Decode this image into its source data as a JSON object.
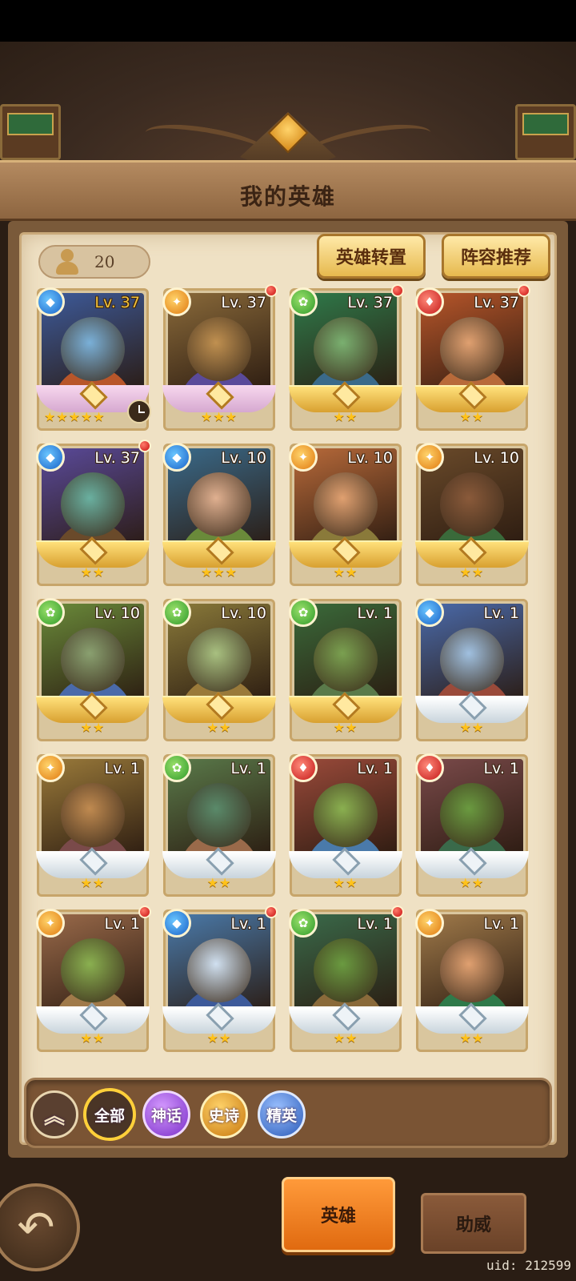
{
  "header": {
    "title": "我的英雄"
  },
  "hero_count": "20",
  "actions": {
    "transfer_label": "英雄转置",
    "lineup_label": "阵容推荐"
  },
  "heroes": [
    {
      "level": "Lv. 37",
      "element": "water",
      "stars": "★★★★★",
      "frame": "pink",
      "red_dot": false,
      "clock": true
    },
    {
      "level": "Lv. 37",
      "element": "light",
      "stars": "★★★",
      "frame": "pink",
      "red_dot": true,
      "clock": false
    },
    {
      "level": "Lv. 37",
      "element": "nature",
      "stars": "★★",
      "frame": "gold",
      "red_dot": true,
      "clock": false
    },
    {
      "level": "Lv. 37",
      "element": "fire",
      "stars": "★★",
      "frame": "gold",
      "red_dot": true,
      "clock": false
    },
    {
      "level": "Lv. 37",
      "element": "water",
      "stars": "★★",
      "frame": "gold",
      "red_dot": true,
      "clock": false
    },
    {
      "level": "Lv. 10",
      "element": "water",
      "stars": "★★★",
      "frame": "gold",
      "red_dot": false,
      "clock": false
    },
    {
      "level": "Lv. 10",
      "element": "light",
      "stars": "★★",
      "frame": "gold",
      "red_dot": false,
      "clock": false
    },
    {
      "level": "Lv. 10",
      "element": "light",
      "stars": "★★",
      "frame": "gold",
      "red_dot": false,
      "clock": false
    },
    {
      "level": "Lv. 10",
      "element": "nature",
      "stars": "★★",
      "frame": "gold",
      "red_dot": false,
      "clock": false
    },
    {
      "level": "Lv. 10",
      "element": "nature",
      "stars": "★★",
      "frame": "gold",
      "red_dot": false,
      "clock": false
    },
    {
      "level": "Lv. 1",
      "element": "nature",
      "stars": "★★",
      "frame": "gold",
      "red_dot": false,
      "clock": false
    },
    {
      "level": "Lv. 1",
      "element": "water",
      "stars": "★★",
      "frame": "silver",
      "red_dot": false,
      "clock": false
    },
    {
      "level": "Lv. 1",
      "element": "light",
      "stars": "★★",
      "frame": "silver",
      "red_dot": false,
      "clock": false
    },
    {
      "level": "Lv. 1",
      "element": "nature",
      "stars": "★★",
      "frame": "silver",
      "red_dot": false,
      "clock": false
    },
    {
      "level": "Lv. 1",
      "element": "fire",
      "stars": "★★",
      "frame": "silver",
      "red_dot": false,
      "clock": false
    },
    {
      "level": "Lv. 1",
      "element": "fire",
      "stars": "★★",
      "frame": "silver",
      "red_dot": false,
      "clock": false
    },
    {
      "level": "Lv. 1",
      "element": "light",
      "stars": "★★",
      "frame": "silver",
      "red_dot": true,
      "clock": false
    },
    {
      "level": "Lv. 1",
      "element": "water",
      "stars": "★★",
      "frame": "silver",
      "red_dot": true,
      "clock": false
    },
    {
      "level": "Lv. 1",
      "element": "nature",
      "stars": "★★",
      "frame": "silver",
      "red_dot": true,
      "clock": false
    },
    {
      "level": "Lv. 1",
      "element": "light",
      "stars": "★★",
      "frame": "silver",
      "red_dot": false,
      "clock": false
    }
  ],
  "filters": {
    "collapse_icon": "double-chevron-up-icon",
    "all": "全部",
    "mythic": "神话",
    "epic": "史诗",
    "elite": "精英"
  },
  "tabs": {
    "hero": "英雄",
    "assist": "助威"
  },
  "footer": {
    "back_icon": "back-arrow-icon",
    "uid": "uid: 212599"
  },
  "colors": {
    "water": "#1a62c8",
    "fire": "#c41818",
    "nature": "#2e9a2a",
    "light": "#e07a10",
    "portrait_bg": [
      "#3d5a9a",
      "#8a6a3a",
      "#2f7a4a",
      "#b8562a",
      "#5a4a9a",
      "#3a6a8a",
      "#b86a3a",
      "#6a4a2a",
      "#6a8a3a",
      "#8a7a3a",
      "#3a6a3a",
      "#4a6aaa",
      "#9a7a3a",
      "#5a7a4a",
      "#9a4a3a",
      "#7a4a4a",
      "#9a6a4a",
      "#4a7aaa",
      "#3a6a4a",
      "#a07a4a"
    ]
  }
}
